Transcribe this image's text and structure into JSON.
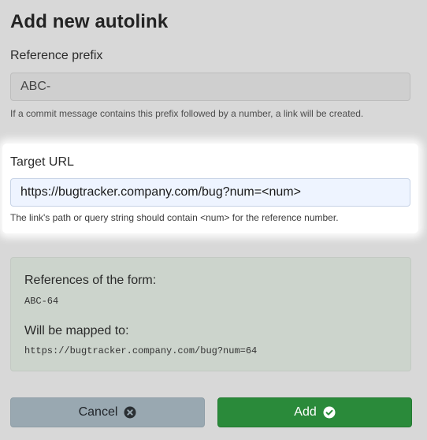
{
  "title": "Add new autolink",
  "reference_prefix": {
    "label": "Reference prefix",
    "value": "ABC-",
    "help": "If a commit message contains this prefix followed by a number, a link will be created."
  },
  "target_url": {
    "label": "Target URL",
    "value": "https://bugtracker.company.com/bug?num=<num>",
    "help": "The link's path or query string should contain <num> for the reference number."
  },
  "preview": {
    "references_label": "References of the form:",
    "references_example": "ABC-64",
    "mapped_label": "Will be mapped to:",
    "mapped_example": "https://bugtracker.company.com/bug?num=64"
  },
  "buttons": {
    "cancel_label": "Cancel",
    "cancel_icon": "times-circle-icon",
    "add_label": "Add",
    "add_icon": "check-circle-icon"
  },
  "colors": {
    "add_button": "#2a8a3a",
    "cancel_button": "#99a8b1",
    "preview_bg": "#ccd4cc",
    "url_input_bg": "#eef4ff"
  }
}
